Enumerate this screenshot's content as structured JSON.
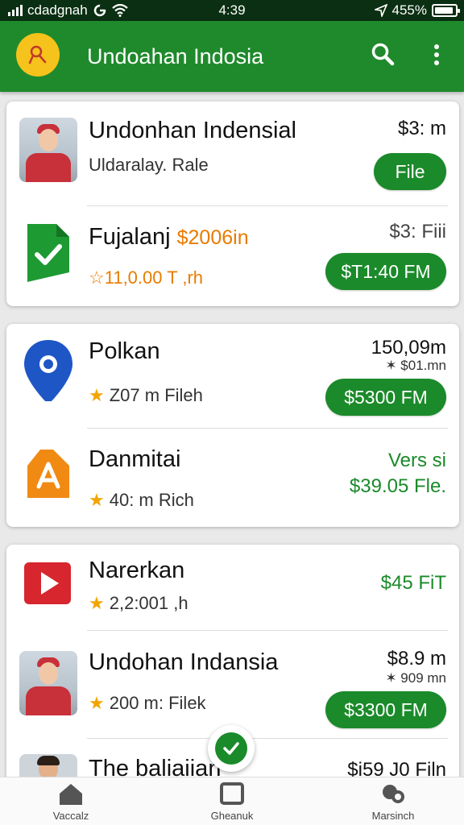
{
  "status_bar": {
    "carrier": "cdadgnah",
    "time": "4:39",
    "battery": "455%"
  },
  "app_bar": {
    "title": "Undoahan Indosia"
  },
  "cards": [
    {
      "rows": [
        {
          "name": "Undonhan Indensial",
          "sub": "Uldaralay. Rale",
          "price": "$3: m",
          "button": "File",
          "icon": "person-avatar"
        },
        {
          "name": "Fujalanj",
          "name_extra": "$2006in",
          "sub_star": "☆",
          "sub": "11,0.00 T ,rh",
          "price": "$3: Fiii",
          "button": "$T1:40 FM",
          "icon": "document-check-icon"
        }
      ]
    },
    {
      "rows": [
        {
          "name": "Polkan",
          "sub_star": "★",
          "sub": "Z07  m Fileh",
          "price": "150,09m",
          "price_small": "✶  $01.mn",
          "button": "$5300 FM",
          "icon": "map-pin-icon"
        },
        {
          "name": "Danmitai",
          "sub_star": "★",
          "sub": "40: m Rich",
          "price": "Vers si",
          "price_line2": "$39.05 Fle.",
          "icon": "warning-house-icon"
        }
      ]
    },
    {
      "rows": [
        {
          "name": "Narerkan",
          "sub_star": "★",
          "sub": "2,2:001 ,h",
          "price": "$45 FiT",
          "icon": "play-icon"
        },
        {
          "name": "Undohan Indansia",
          "sub_star": "★",
          "sub": "200  m: Filek",
          "price": "$8.9 m",
          "price_small": "✶  909 mn",
          "button": "$3300 FM",
          "icon": "person-avatar"
        },
        {
          "name": "The baliaiian",
          "price": "$i59 J0 Filn",
          "icon": "person-avatar-male"
        }
      ]
    }
  ],
  "bottom_nav": [
    {
      "label": "Vaccalz",
      "icon": "home-icon"
    },
    {
      "label": "Gheanuk",
      "icon": "square-icon"
    },
    {
      "label": "Marsinch",
      "icon": "chat-icon"
    }
  ],
  "colors": {
    "primary": "#1f8a2c",
    "button": "#1b8a2a",
    "accent_orange": "#e87b00",
    "star": "#f2a500"
  }
}
